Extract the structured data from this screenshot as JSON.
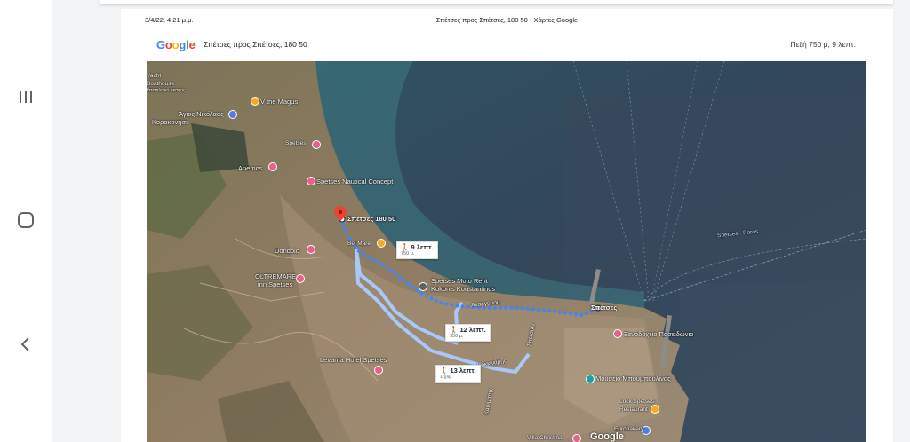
{
  "nav": {
    "recents_icon": "recents-icon",
    "home_icon": "home-icon",
    "back_icon": "back-icon"
  },
  "print_header": {
    "datetime": "3/4/22, 4:21 μ.μ.",
    "page_title": "Σπέτσες προς Σπέτσες, 180 50 - Χάρτες Google"
  },
  "directions": {
    "logo": "Google",
    "route": "Σπέτσες προς Σπέτσες, 180 50",
    "summary": "Πεζή 750 μ, 9 λεπτ."
  },
  "map": {
    "labels": {
      "yacht": "Yacht",
      "boathouse": "Boathouse",
      "boathouse_sub": "Ιστιοπλοϊκό σκάφος",
      "magus": "V the Magus",
      "agios_nikolaos": "Άγιος Νικόλαος",
      "korakonisi": "Κορακονήσι",
      "spetses_small": "Spetses",
      "anemos": "Anemos",
      "nautical": "Spetses Nautical Concept",
      "destination": "Σπέτσες 180 50",
      "bel_mare": "Bel Mare",
      "dondolo": "Dondolo",
      "oltremare": "OLTREMARE",
      "oltremare_sub": "inn Spetses",
      "moto_rent": "Spetses Moto Rent",
      "moto_rent_sub": "Kokonis Konstantinos",
      "anargyrou": "Αναργύρου",
      "spetses_port": "Σπέτσες",
      "levanta": "Levanta Hotel Spetses",
      "kokkinaris": "Κοκκινάρης",
      "street_mid": "Σπετσών",
      "kasimatis": "Κασιμάτης",
      "poseidonion": "Ξενοδοχείο Ποσειδώνιο",
      "bouboulina": "Μουσείο Μπουμπουλίνας",
      "lock": "Lock Spetses",
      "lock_sub": "Restaurant",
      "bakery": "Eurobakery",
      "villa": "Villa Christina",
      "ferry": "Spetses - Poros",
      "watermark": "Google"
    },
    "callouts": [
      {
        "time": "9 λεπτ.",
        "dist": "750 μ."
      },
      {
        "time": "12 λεπτ.",
        "dist": "950 μ."
      },
      {
        "time": "13 λεπτ.",
        "dist": "1 χλμ."
      }
    ],
    "colors": {
      "route": "#4285f4",
      "alt_route": "#a8c7fa",
      "pin_red": "#ea4335",
      "poi_pink": "#e8608c",
      "poi_orange": "#f9a825",
      "poi_teal": "#1aa1a1",
      "poi_blue": "#4f7ce8"
    }
  }
}
